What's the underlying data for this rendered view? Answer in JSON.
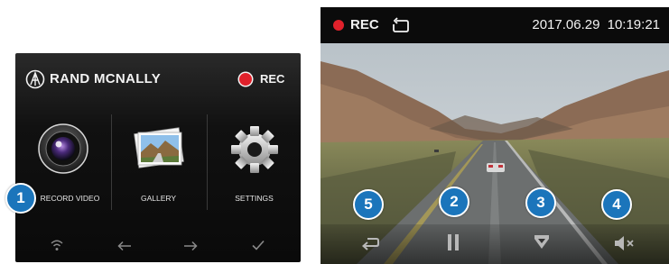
{
  "menu_screen": {
    "brand": "RAND MCNALLY",
    "rec_label": "REC",
    "tiles": [
      {
        "label": "RECORD VIDEO",
        "icon": "camera-lens-icon"
      },
      {
        "label": "GALLERY",
        "icon": "photo-gallery-icon"
      },
      {
        "label": "SETTINGS",
        "icon": "gear-icon"
      }
    ],
    "bottom_nav": [
      {
        "icon": "wifi-icon",
        "glyph": "•"
      },
      {
        "icon": "arrow-left-icon",
        "glyph": "←"
      },
      {
        "icon": "arrow-right-icon",
        "glyph": "→"
      },
      {
        "icon": "checkmark-icon",
        "glyph": "✓"
      }
    ]
  },
  "recording_screen": {
    "rec_label": "REC",
    "date": "2017.06.29",
    "time": "10:19:21",
    "controls": [
      {
        "icon": "return-icon"
      },
      {
        "icon": "pause-icon"
      },
      {
        "icon": "protect-file-icon"
      },
      {
        "icon": "mute-icon"
      }
    ]
  },
  "callouts": [
    "1",
    "2",
    "3",
    "4",
    "5"
  ],
  "colors": {
    "rec_red": "#e0212b",
    "callout_blue": "#1b75bb"
  }
}
